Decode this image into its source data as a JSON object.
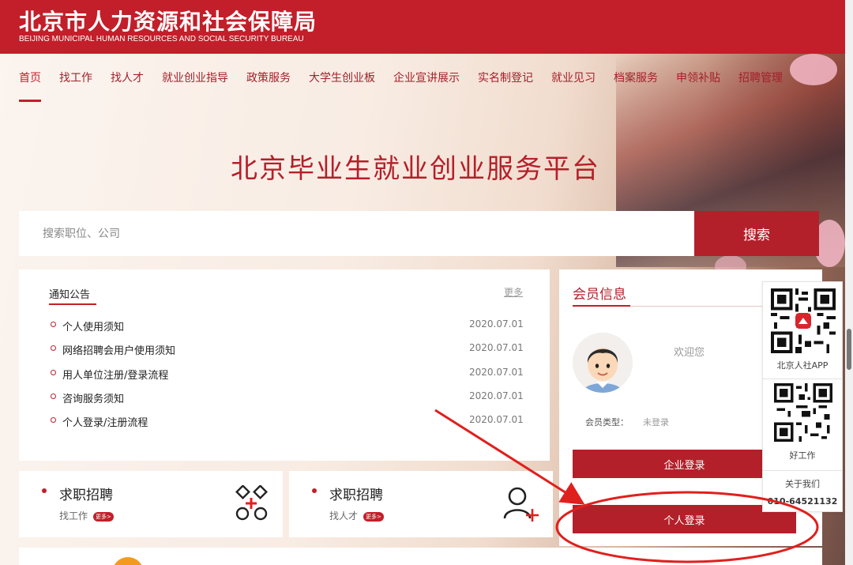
{
  "header": {
    "title_cn": "北京市人力资源和社会保障局",
    "title_en": "BEIJING MUNICIPAL HUMAN RESOURCES AND SOCIAL SECURITY BUREAU"
  },
  "nav": {
    "items": [
      {
        "label": "首页"
      },
      {
        "label": "找工作"
      },
      {
        "label": "找人才"
      },
      {
        "label": "就业创业指导"
      },
      {
        "label": "政策服务"
      },
      {
        "label": "大学生创业板"
      },
      {
        "label": "企业宣讲展示"
      },
      {
        "label": "实名制登记"
      },
      {
        "label": "就业见习"
      },
      {
        "label": "档案服务"
      },
      {
        "label": "申领补贴"
      },
      {
        "label": "招聘管理"
      }
    ],
    "active_index": 0
  },
  "platform_title": "北京毕业生就业创业服务平台",
  "search": {
    "placeholder": "搜索职位、公司",
    "button_label": "搜索"
  },
  "notice": {
    "title": "通知公告",
    "more_label": "更多",
    "items": [
      {
        "text": "个人使用须知",
        "date": "2020.07.01"
      },
      {
        "text": "网络招聘会用户使用须知",
        "date": "2020.07.01"
      },
      {
        "text": "用人单位注册/登录流程",
        "date": "2020.07.01"
      },
      {
        "text": "咨询服务须知",
        "date": "2020.07.01"
      },
      {
        "text": "个人登录/注册流程",
        "date": "2020.07.01"
      }
    ]
  },
  "cards": [
    {
      "title": "求职招聘",
      "sub": "找工作",
      "badge": "更多>",
      "icon": "apps-plus-icon"
    },
    {
      "title": "求职招聘",
      "sub": "找人才",
      "badge": "更多>",
      "icon": "user-add-icon"
    }
  ],
  "member": {
    "title": "会员信息",
    "welcome": "欢迎您",
    "type_label": "会员类型：",
    "type_value": "未登录",
    "company_login": "企业登录",
    "personal_login": "个人登录"
  },
  "qr_sidebar": {
    "app_label": "北京人社APP",
    "job_label": "好工作",
    "about_label": "关于我们",
    "phone": "010-64521132"
  },
  "colors": {
    "brand_red": "#c21f2a",
    "annotation_red": "#e0201d"
  }
}
